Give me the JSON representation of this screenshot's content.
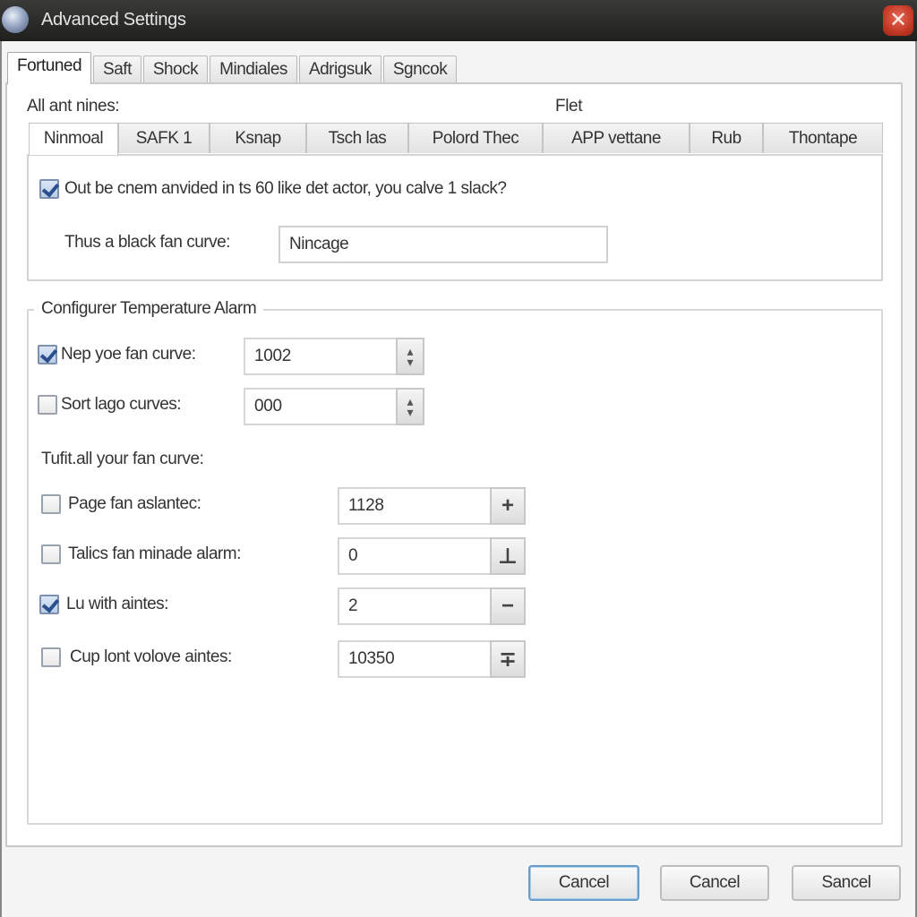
{
  "window": {
    "title": "Advanced Settings",
    "icon": "app-globe-icon",
    "close_icon": "✕"
  },
  "main_tabs": [
    {
      "label": "Fortuned",
      "active": true
    },
    {
      "label": "Saft",
      "active": false
    },
    {
      "label": "Shock",
      "active": false
    },
    {
      "label": "Mindiales",
      "active": false
    },
    {
      "label": "Adrigsuk",
      "active": false
    },
    {
      "label": "Sgncok",
      "active": false
    }
  ],
  "sub_section": {
    "left_label": "All ant nines:",
    "right_label": "Flet",
    "tabs": [
      {
        "label": "Ninmoal",
        "active": true
      },
      {
        "label": "SAFK 1",
        "active": false
      },
      {
        "label": "Ksnap",
        "active": false
      },
      {
        "label": "Tsch las",
        "active": false
      },
      {
        "label": "Polord Thec",
        "active": false
      },
      {
        "label": "APP vettane",
        "active": false
      },
      {
        "label": "Rub",
        "active": false
      },
      {
        "label": "Thontape",
        "active": false
      }
    ],
    "checkbox": {
      "label": "Out be cnem anvided in ts 60 like det actor, you calve 1 slack?",
      "checked": true
    },
    "field": {
      "label": "Thus a black fan curve:",
      "value": "Nincage"
    }
  },
  "temperature_alarm": {
    "title": "Configurer Temperature Alarm",
    "spin_rows": [
      {
        "label": "Nep yoe fan curve:",
        "checked": true,
        "value": "1002",
        "up_icon": "▴",
        "down_icon": "▾"
      },
      {
        "label": "Sort lago curves:",
        "checked": false,
        "value": "000",
        "up_icon": "▴",
        "down_icon": "▾"
      }
    ],
    "subheading": "Tufit.all your fan curve:",
    "step_rows": [
      {
        "label": "Page fan aslantec:",
        "checked": false,
        "value": "1128",
        "button_icon": "plus-icon",
        "button_glyph": "+"
      },
      {
        "label": "Talics fan minade alarm:",
        "checked": false,
        "value": "0",
        "button_icon": "plus-minus-icon",
        "button_glyph": "⊥"
      },
      {
        "label": "Lu with aintes:",
        "checked": true,
        "value": "2",
        "button_icon": "minus-icon",
        "button_glyph": "−"
      },
      {
        "label": "Cup lont volove aintes:",
        "checked": false,
        "value": "10350",
        "button_icon": "plus-icon",
        "button_glyph": "∓"
      }
    ]
  },
  "footer": {
    "buttons": [
      {
        "label": "Cancel",
        "default": true
      },
      {
        "label": "Cancel",
        "default": false
      },
      {
        "label": "Sancel",
        "default": false
      }
    ]
  }
}
